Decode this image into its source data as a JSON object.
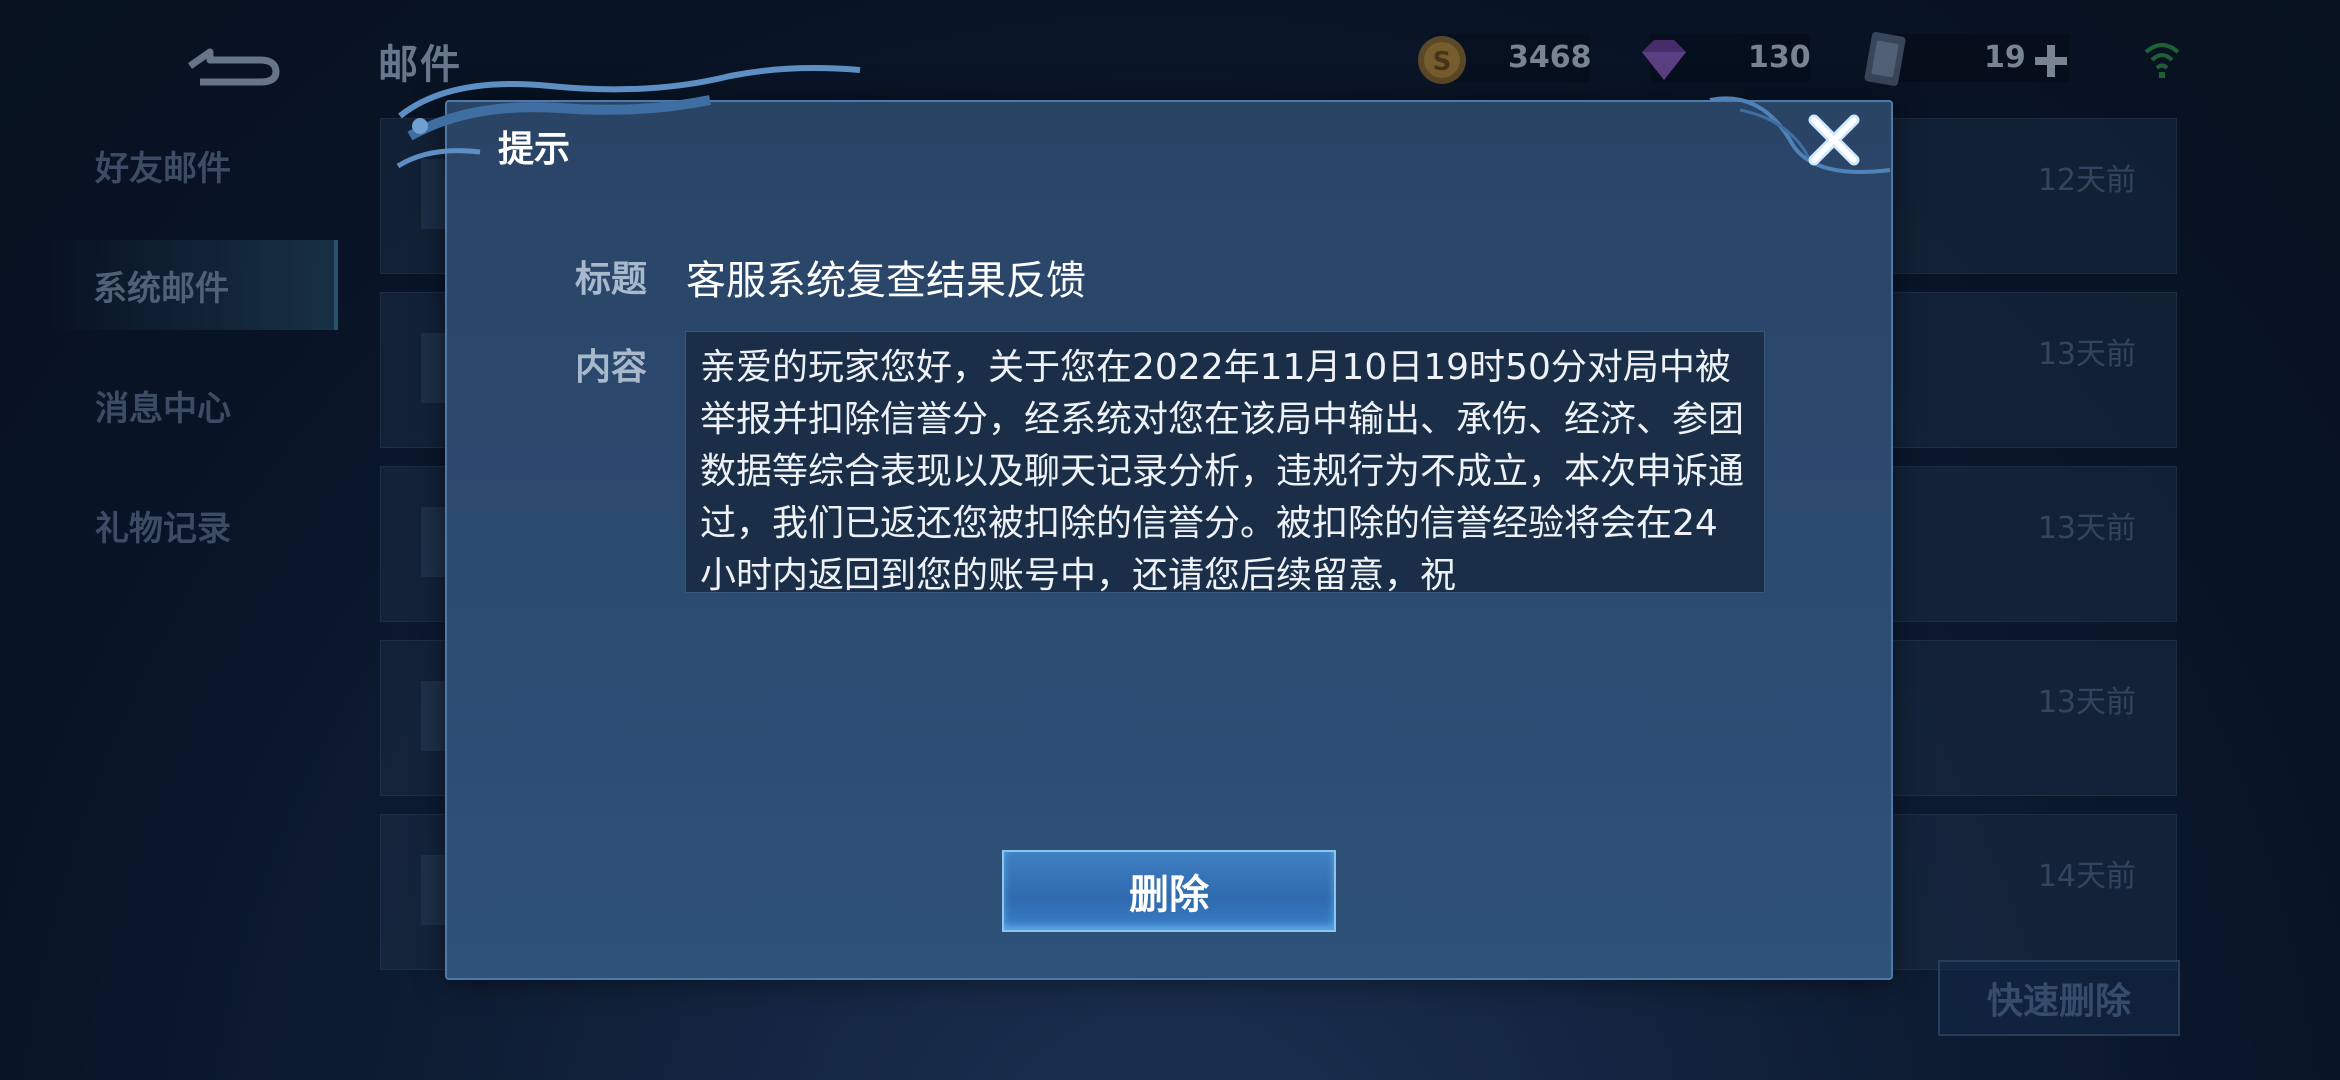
{
  "header": {
    "title": "邮件",
    "coins": "3468",
    "gems": "130",
    "tickets": "19"
  },
  "sidebar": {
    "items": [
      {
        "label": "好友邮件"
      },
      {
        "label": "系统邮件"
      },
      {
        "label": "消息中心"
      },
      {
        "label": "礼物记录"
      }
    ]
  },
  "mail_list": {
    "rows": [
      {
        "time": "12天前"
      },
      {
        "time": "13天前"
      },
      {
        "time": "13天前"
      },
      {
        "time": "13天前"
      },
      {
        "time": "14天前"
      }
    ]
  },
  "quick_delete_label": "快速删除",
  "dialog": {
    "title": "提示",
    "subject_label": "标题",
    "subject": "客服系统复查结果反馈",
    "content_label": "内容",
    "content": "亲爱的玩家您好，关于您在2022年11月10日19时50分对局中被举报并扣除信誉分，经系统对您在该局中输出、承伤、经济、参团数据等综合表现以及聊天记录分析，违规行为不成立，本次申诉通过，我们已返还您被扣除的信誉分。被扣除的信誉经验将会在24小时内返回到您的账号中，还请您后续留意，祝",
    "delete_label": "删除"
  }
}
